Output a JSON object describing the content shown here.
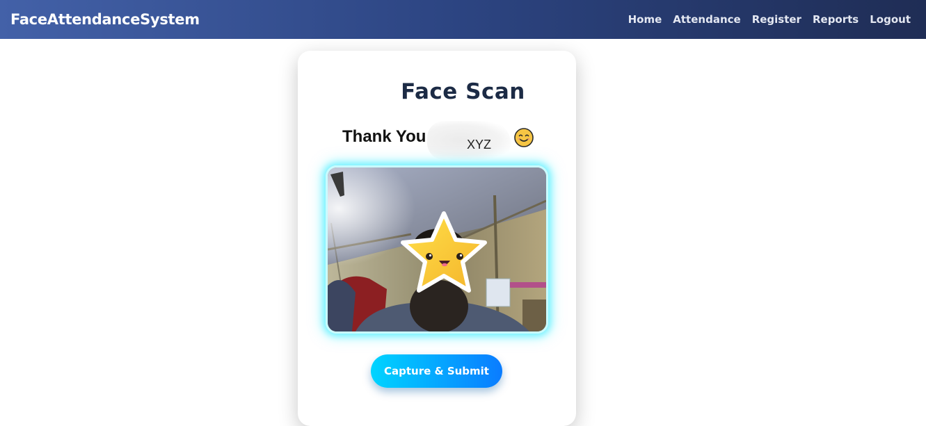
{
  "navbar": {
    "brand": "FaceAttendanceSystem",
    "links": [
      "Home",
      "Attendance",
      "Register",
      "Reports",
      "Logout"
    ]
  },
  "card": {
    "title": "Face Scan",
    "greeting": "Thank You",
    "name": "XYZ",
    "emoji": "smiling-face-icon",
    "capture_button": "Capture & Submit"
  },
  "colors": {
    "nav_start": "#4361a8",
    "nav_end": "#1f2d55",
    "title": "#1c2b45",
    "button_start": "#00d4ff",
    "button_end": "#0a7cff",
    "video_glow": "#6ff2ff"
  }
}
